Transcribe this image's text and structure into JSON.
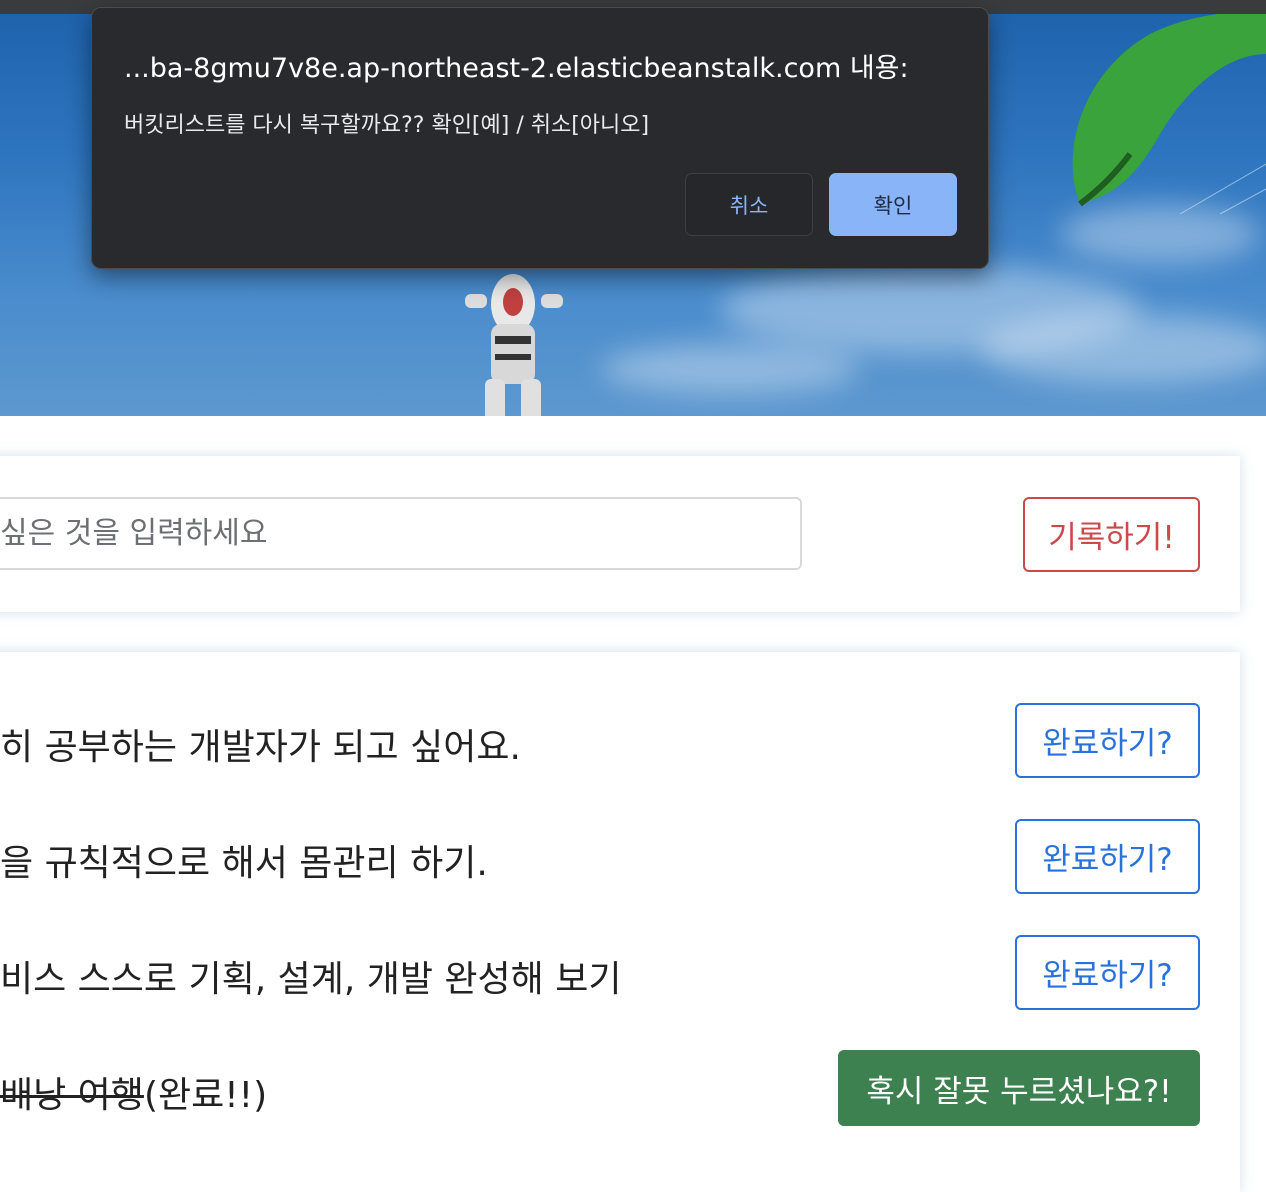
{
  "dialog": {
    "title": "...ba-8gmu7v8e.ap-northeast-2.elasticbeanstalk.com 내용:",
    "message": "버킷리스트를 다시 복구할까요?? 확인[예] / 취소[아니오]",
    "cancel_label": "취소",
    "ok_label": "확인"
  },
  "form": {
    "placeholder": "싶은 것을 입력하세요",
    "record_label": "기록하기!"
  },
  "items": [
    {
      "text": "히 공부하는 개발자가 되고 싶어요.",
      "button": "완료하기?",
      "done": false
    },
    {
      "text": "을 규칙적으로 해서 몸관리 하기.",
      "button": "완료하기?",
      "done": false
    },
    {
      "text": "비스 스스로 기획, 설계, 개발 완성해 보기",
      "button": "완료하기?",
      "done": false
    },
    {
      "text": "배낭 여행",
      "suffix": "(완료!!)",
      "button": "혹시 잘못 누르셨나요?!",
      "done": true
    }
  ],
  "colors": {
    "record": "#c94a4a",
    "done_button": "#2a72db",
    "undo_button": "#3d8151",
    "dialog_bg": "#282a2e",
    "dialog_accent": "#8ab4f8"
  }
}
